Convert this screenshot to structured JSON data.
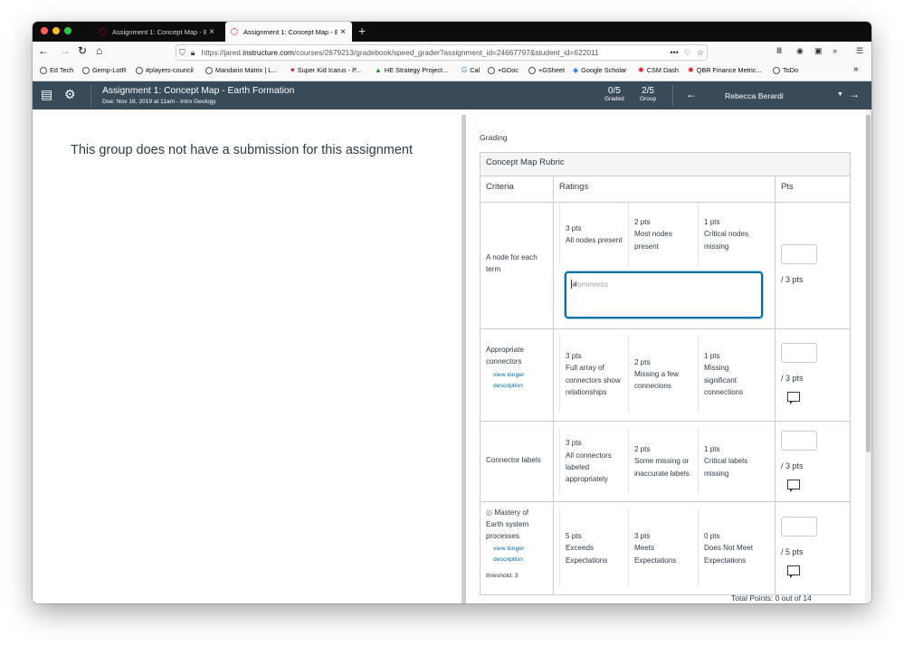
{
  "browser": {
    "tabs": [
      {
        "title": "Assignment 1: Concept Map - E",
        "active": false
      },
      {
        "title": "Assignment 1: Concept Map - E",
        "active": true
      }
    ],
    "url_prefix": "https://jared.",
    "url_domain": "instructure.com",
    "url_path": "/courses/2679213/gradebook/speed_grader?assignment_id=24667797&student_id=622011",
    "bookmarks": [
      "Ed Tech",
      "Gemp-LotR",
      "#players-council",
      "Mandarin Matrix | L...",
      "Super Kid Icarus - P...",
      "HE Strategy Project...",
      "Cal",
      "+GDoc",
      "+GSheet",
      "Google Scholar",
      "CSM Dash",
      "QBR Finance Metric...",
      "ToDo"
    ]
  },
  "header": {
    "assignment_title": "Assignment 1: Concept Map - Earth Formation",
    "due": "Due: Nov 18, 2019 at 11am - Intro Geology",
    "graded_count": "0/5",
    "graded_label": "Graded",
    "group_count": "2/5",
    "group_label": "Group",
    "student_name": "Rebecca Berardi"
  },
  "left": {
    "message": "This group does not have a submission for this assignment"
  },
  "grading": {
    "label": "Grading",
    "rubric_title": "Concept Map Rubric",
    "col_criteria": "Criteria",
    "col_ratings": "Ratings",
    "col_pts": "Pts",
    "comments_placeholder": "Comments",
    "view_longer": [
      "view longer",
      "description"
    ],
    "threshold": "threshold: 3",
    "rows": [
      {
        "criterion": "A node for each term",
        "ratings": [
          [
            "3 pts",
            "All nodes present"
          ],
          [
            "2 pts",
            "Most nodes present"
          ],
          [
            "1 pts",
            "Critical nodes missing"
          ]
        ],
        "pts": "/ 3 pts"
      },
      {
        "criterion": "Appropriate connectors",
        "ratings": [
          [
            "3 pts",
            "Full array of connectors show relationships"
          ],
          [
            "2 pts",
            "Missing a few connecions"
          ],
          [
            "1 pts",
            "Missing significant connections"
          ]
        ],
        "pts": "/ 3 pts"
      },
      {
        "criterion": "Connector labels",
        "ratings": [
          [
            "3 pts",
            "All connectors labeled appropriately"
          ],
          [
            "2 pts",
            "Some missing or inaccurate labels"
          ],
          [
            "1 pts",
            "Critical labels missing"
          ]
        ],
        "pts": "/ 3 pts"
      },
      {
        "criterion": "Mastery of Earth system processes",
        "ratings": [
          [
            "5 pts",
            "Exceeds Expectations"
          ],
          [
            "3 pts",
            "Meets Expectations"
          ],
          [
            "0 pts",
            "Does Not Meet Expectations"
          ]
        ],
        "pts": "/ 5 pts"
      }
    ],
    "total": "Total Points: 0 out of 14"
  }
}
